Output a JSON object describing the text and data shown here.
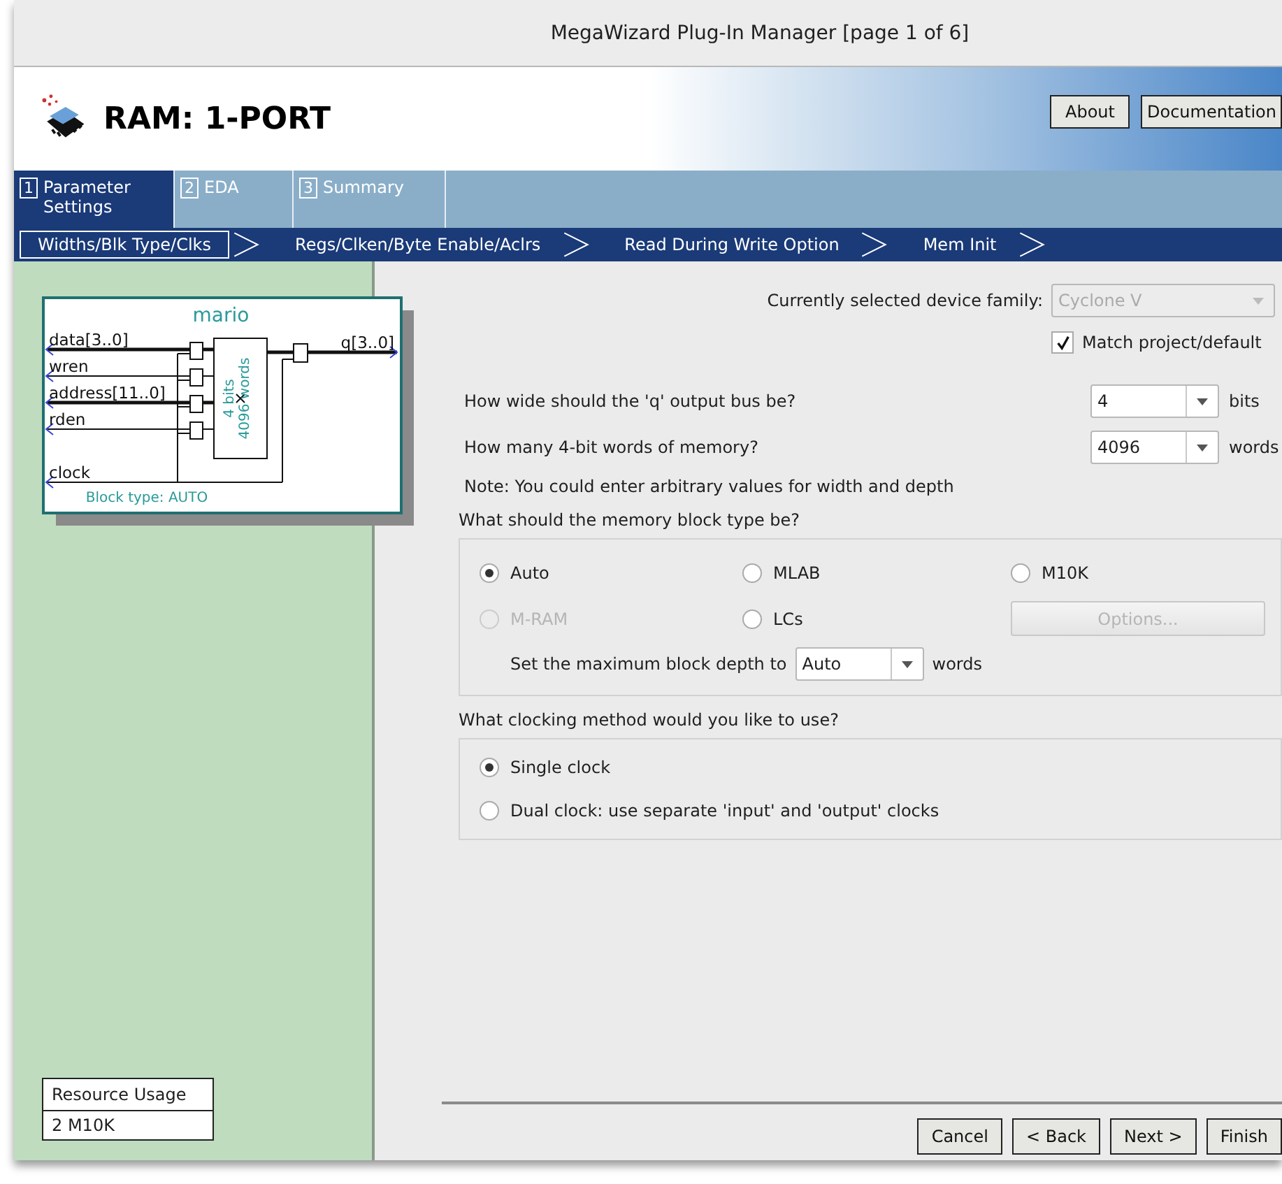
{
  "window": {
    "title": "MegaWizard Plug-In Manager [page 1 of 6]"
  },
  "header": {
    "title": "RAM: 1-PORT",
    "buttons": [
      {
        "label": "About"
      },
      {
        "label": "Documentation"
      }
    ]
  },
  "tabs": [
    {
      "number": "1",
      "label": "Parameter Settings",
      "selected": true
    },
    {
      "number": "2",
      "label": "EDA",
      "selected": false
    },
    {
      "number": "3",
      "label": "Summary",
      "selected": false
    }
  ],
  "steps": [
    {
      "label": "Widths/Blk Type/Clks",
      "selected": true
    },
    {
      "label": "Regs/Clken/Byte Enable/Aclrs",
      "selected": false
    },
    {
      "label": "Read During Write Option",
      "selected": false
    },
    {
      "label": "Mem Init",
      "selected": false
    }
  ],
  "diagram": {
    "name": "mario",
    "inputs": [
      {
        "label": "data[3..0]",
        "bus": true
      },
      {
        "label": "wren",
        "bus": false
      },
      {
        "label": "address[11..0]",
        "bus": true
      },
      {
        "label": "rden",
        "bus": false
      }
    ],
    "clock": "clock",
    "output": "q[3..0]",
    "block_width": "4 bits",
    "block_depth": "4096 words",
    "block_type": "Block type: AUTO"
  },
  "resource_usage": {
    "title": "Resource Usage",
    "value": "2 M10K"
  },
  "device": {
    "label": "Currently selected device family:",
    "value": "Cyclone V",
    "disabled": true,
    "match": {
      "label": "Match project/default",
      "checked": true
    }
  },
  "questions": [
    {
      "label": "How wide should the 'q' output bus be?",
      "value": "4",
      "unit": "bits"
    },
    {
      "label": "How many 4-bit words of memory?",
      "value": "4096",
      "unit": "words"
    }
  ],
  "note": "Note: You could enter arbitrary values for width and depth",
  "block_type": {
    "question": "What should the memory block type be?",
    "options": [
      {
        "label": "Auto",
        "selected": true,
        "disabled": false
      },
      {
        "label": "MLAB",
        "selected": false,
        "disabled": false
      },
      {
        "label": "M10K",
        "selected": false,
        "disabled": false
      },
      {
        "label": "M-RAM",
        "selected": false,
        "disabled": true
      },
      {
        "label": "LCs",
        "selected": false,
        "disabled": false
      }
    ],
    "options_button": {
      "label": "Options...",
      "disabled": true
    },
    "depth": {
      "label": "Set the maximum block depth to",
      "value": "Auto",
      "unit": "words"
    }
  },
  "clocking": {
    "question": "What clocking method would you like to use?",
    "options": [
      {
        "label": "Single clock",
        "selected": true
      },
      {
        "label": "Dual clock: use separate 'input' and 'output' clocks",
        "selected": false
      }
    ]
  },
  "footer_buttons": [
    {
      "label": "Cancel"
    },
    {
      "label": "< Back"
    },
    {
      "label": "Next >"
    },
    {
      "label": "Finish"
    }
  ]
}
